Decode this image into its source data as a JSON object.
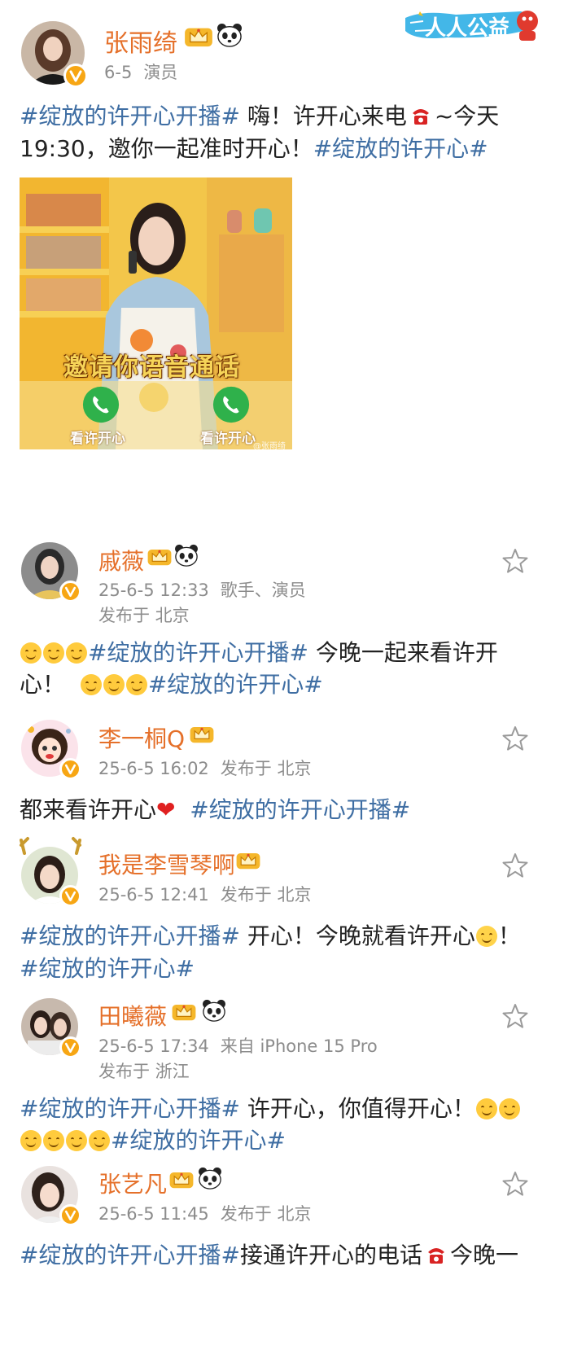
{
  "post": {
    "author": "张雨绮",
    "date": "6-5",
    "role": "演员",
    "line1": {
      "tag": "#绽放的许开心开播#",
      "text": " 嗨！许开心来电",
      "tail": "~今天"
    },
    "line2": {
      "text": "19:30，邀你一起准时开心！",
      "tag": "#绽放的许开心#"
    },
    "image": {
      "overlay_title": "邀请你语音通话",
      "call_label_left": "看许开心",
      "call_label_right": "看许开心",
      "watermark": "@张雨绮"
    },
    "corner_badge": "人人公益"
  },
  "comments": [
    {
      "name": "戚薇",
      "time": "25-6-5 12:33",
      "extra": "歌手、演员",
      "location": "发布于 北京",
      "line1": {
        "tag": "#绽放的许开心开播#",
        "text": " 今晚一起来看许开"
      },
      "line2": {
        "text": "心！",
        "tag": "#绽放的许开心#"
      }
    },
    {
      "name": "李一桐Q",
      "time": "25-6-5 16:02",
      "location": "发布于 北京",
      "line1": {
        "text": "都来看许开心",
        "tag": "#绽放的许开心开播#"
      }
    },
    {
      "name": "我是李雪琴啊",
      "time": "25-6-5 12:41",
      "location": "发布于 北京",
      "line1": {
        "tag": "#绽放的许开心开播#",
        "text": " 开心！今晚就看许开心",
        "tail": "！"
      },
      "line2": {
        "tag": "#绽放的许开心#"
      }
    },
    {
      "name": "田曦薇",
      "time": "25-6-5 17:34",
      "device": "来自 iPhone 15 Pro",
      "location": "发布于 浙江",
      "line1": {
        "tag": "#绽放的许开心开播#",
        "text": " 许开心，你值得开心！"
      },
      "line2": {
        "tag": "#绽放的许开心#"
      }
    },
    {
      "name": "张艺凡",
      "time": "25-6-5 11:45",
      "location": "发布于 北京",
      "line1": {
        "tag": "#绽放的许开心开播#",
        "text": "接通许开心的电话",
        "tail": "今晚一"
      }
    }
  ],
  "colors": {
    "name": "#e5702a",
    "hashtag": "#3f6ea3",
    "meta": "#8c8c8c",
    "verified": "#f7a614"
  },
  "icons": [
    "crown-icon",
    "panda-icon",
    "verified-icon",
    "star-icon",
    "phone-emoji",
    "heart-emoji",
    "smile-emoji"
  ]
}
